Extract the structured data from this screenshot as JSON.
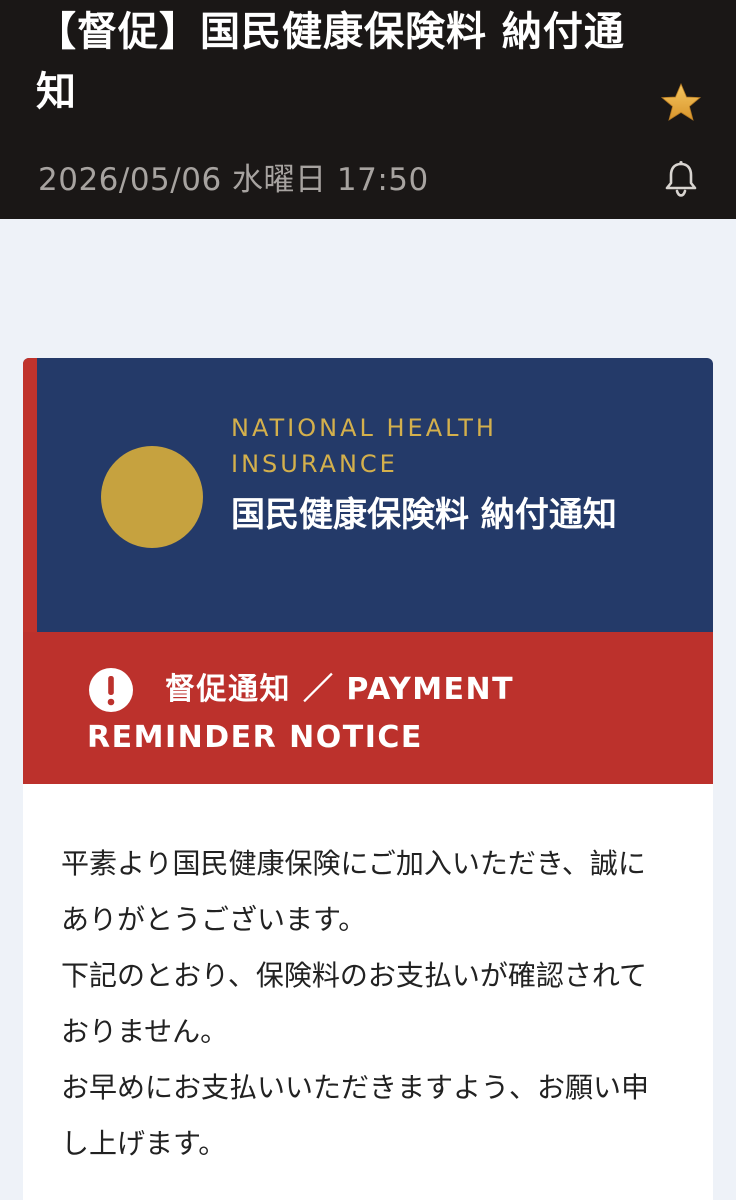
{
  "header": {
    "subject": "【督促】国民健康保険料 納付通知",
    "datetime": "2026/05/06 水曜日 17:50",
    "star_icon": "star-icon",
    "bell_icon": "bell-icon"
  },
  "card": {
    "eyebrow": "NATIONAL HEALTH INSURANCE",
    "title": "国民健康保険料 納付通知",
    "seal_icon": "gold-seal-icon",
    "alert": {
      "icon": "exclamation-circle-icon",
      "text": "督促通知 ／ PAYMENT REMINDER NOTICE"
    },
    "body_lines": [
      "平素より国民健康保険にご加入いただき、誠にありがとうございます。",
      "下記のとおり、保険料のお支払いが確認されておりません。",
      "お早めにお支払いいただきますよう、お願い申し上げます。"
    ]
  },
  "colors": {
    "header_bg": "#1a1716",
    "page_bg": "#eef2f8",
    "banner_navy": "#243a69",
    "accent_gold": "#c6a23f",
    "alert_red": "#bc312c",
    "star_gold": "#e7a93a"
  }
}
